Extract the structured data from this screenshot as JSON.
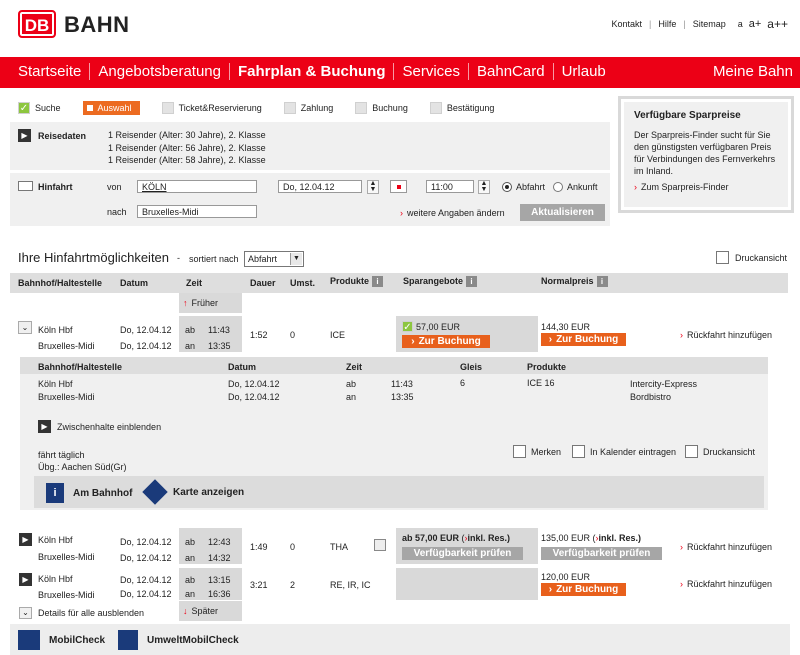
{
  "logo": {
    "box": "DB",
    "text": "BAHN"
  },
  "toplinks": {
    "kontakt": "Kontakt",
    "hilfe": "Hilfe",
    "sitemap": "Sitemap",
    "a1": "a",
    "a2": "a+",
    "a3": "a++"
  },
  "nav": {
    "items": [
      "Startseite",
      "Angebotsberatung",
      "Fahrplan & Buchung",
      "Services",
      "BahnCard",
      "Urlaub"
    ],
    "right": "Meine Bahn"
  },
  "steps": [
    "Suche",
    "Auswahl",
    "Ticket&Reservierung",
    "Zahlung",
    "Buchung",
    "Bestätigung"
  ],
  "reisedaten": {
    "label": "Reisedaten",
    "lines": [
      "1 Reisender (Alter: 30 Jahre), 2. Klasse",
      "1 Reisender (Alter: 56 Jahre), 2. Klasse",
      "1 Reisender (Alter: 58 Jahre), 2. Klasse"
    ]
  },
  "hinfahrt": {
    "label": "Hinfahrt",
    "von_label": "von",
    "von_value": "KÖLN",
    "nach_label": "nach",
    "nach_value": "Bruxelles-Midi",
    "date": "Do, 12.04.12",
    "time": "11:00",
    "abfahrt": "Abfahrt",
    "ankunft": "Ankunft",
    "weitere": "weitere Angaben ändern",
    "aktualisieren": "Aktualisieren"
  },
  "sidebar": {
    "title": "Verfügbare Sparpreise",
    "text": "Der Sparpreis-Finder sucht für Sie den günstigsten verfügbaren Preis für Verbindungen des Fernverkehrs im Inland.",
    "link": "Zum Sparpreis-Finder"
  },
  "results": {
    "title": "Ihre Hinfahrtmöglichkeiten",
    "dash": "-",
    "sort_label": "sortiert nach",
    "sort_value": "Abfahrt",
    "print": "Druckansicht",
    "headers": {
      "station": "Bahnhof/Haltestelle",
      "date": "Datum",
      "time": "Zeit",
      "duration": "Dauer",
      "changes": "Umst.",
      "products": "Produkte",
      "sparangebote": "Sparangebote",
      "normalpreis": "Normalpreis"
    },
    "earlier": "Früher",
    "later": "Später",
    "book": "Zur Buchung",
    "check": "Verfügbarkeit prüfen",
    "return": "Rückfahrt hinzufügen",
    "hide_all": "Details für alle ausblenden",
    "connections": [
      {
        "from": "Köln Hbf",
        "to": "Bruxelles-Midi",
        "date1": "Do, 12.04.12",
        "date2": "Do, 12.04.12",
        "ab": "ab",
        "an": "an",
        "dep": "11:43",
        "arr": "13:35",
        "duration": "1:52",
        "changes": "0",
        "products": "ICE",
        "spar": "57,00 EUR",
        "normal": "144,30 EUR"
      },
      {
        "from": "Köln Hbf",
        "to": "Bruxelles-Midi",
        "date1": "Do, 12.04.12",
        "date2": "Do, 12.04.12",
        "ab": "ab",
        "an": "an",
        "dep": "12:43",
        "arr": "14:32",
        "duration": "1:49",
        "changes": "0",
        "products": "THA",
        "spar": "ab 57,00 EUR",
        "spar_res": "inkl. Res.)",
        "normal": "135,00 EUR",
        "normal_res": "inkl. Res.)"
      },
      {
        "from": "Köln Hbf",
        "to": "Bruxelles-Midi",
        "date1": "Do, 12.04.12",
        "date2": "Do, 12.04.12",
        "ab": "ab",
        "an": "an",
        "dep": "13:15",
        "arr": "16:36",
        "duration": "3:21",
        "changes": "2",
        "products": "RE, IR, IC",
        "spar": "",
        "normal": "120,00 EUR"
      }
    ],
    "detail": {
      "headers": {
        "station": "Bahnhof/Haltestelle",
        "date": "Datum",
        "time": "Zeit",
        "gleis": "Gleis",
        "products": "Produkte"
      },
      "rows": [
        {
          "station": "Köln Hbf",
          "date": "Do, 12.04.12",
          "abán": "ab",
          "time": "11:43",
          "gleis": "6",
          "product": "ICE 16",
          "extra": "Intercity-Express"
        },
        {
          "station": "Bruxelles-Midi",
          "date": "Do, 12.04.12",
          "abán": "an",
          "time": "13:35",
          "gleis": "",
          "product": "",
          "extra": "Bordbistro"
        }
      ],
      "zwischenhalte": "Zwischenhalte einblenden",
      "note1": "fährt täglich",
      "note2": "Übg.: Aachen Süd(Gr)",
      "merken": "Merken",
      "kalender": "In Kalender eintragen",
      "druck": "Druckansicht",
      "bahnhof": "Am Bahnhof",
      "karte": "Karte anzeigen"
    }
  },
  "footer": {
    "mobilcheck": "MobilCheck",
    "umwelt": "UmweltMobilCheck"
  },
  "colors": {
    "brand": "#ec0016",
    "orange": "#e8601c",
    "gray": "#d9d9d9"
  }
}
